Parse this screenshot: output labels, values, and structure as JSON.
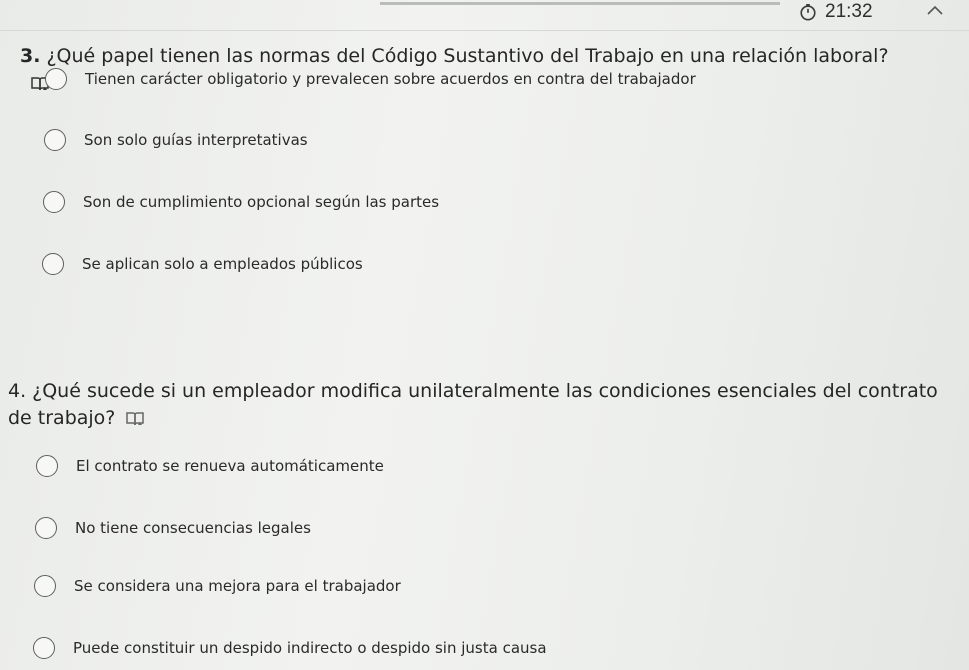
{
  "timer": {
    "icon": "stopwatch-icon",
    "time": "21:32"
  },
  "questions": [
    {
      "number": "3.",
      "text": "¿Qué papel tienen las normas del Código Sustantivo del Trabajo en una relación laboral?",
      "options": [
        "Tienen carácter obligatorio y prevalecen sobre acuerdos en contra del trabajador",
        "Son solo guías interpretativas",
        "Son de cumplimiento opcional según las partes",
        "Se aplican solo a empleados públicos"
      ]
    },
    {
      "number": "4.",
      "text": "¿Qué sucede si un empleador modifica unilateralmente las condiciones esenciales del contrato de trabajo?",
      "options": [
        "El contrato se renueva automáticamente",
        "No tiene consecuencias legales",
        "Se considera una mejora para el trabajador",
        "Puede constituir un despido indirecto o despido sin justa causa"
      ]
    }
  ]
}
